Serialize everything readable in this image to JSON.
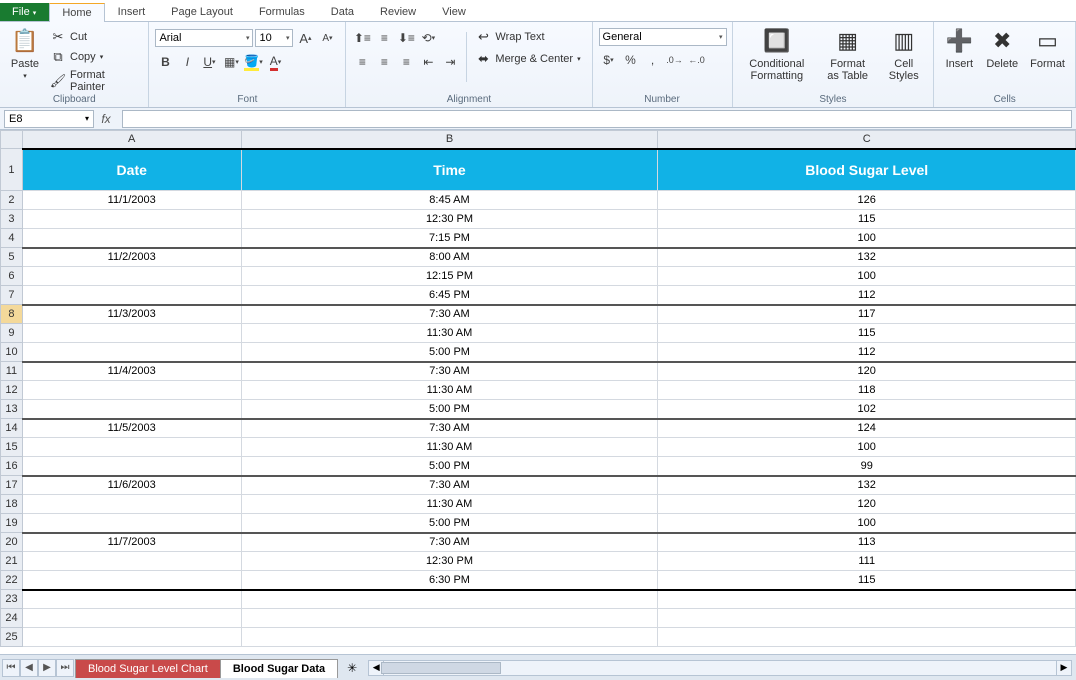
{
  "tabs": {
    "file": "File",
    "home": "Home",
    "insert": "Insert",
    "page_layout": "Page Layout",
    "formulas": "Formulas",
    "data": "Data",
    "review": "Review",
    "view": "View"
  },
  "clipboard": {
    "paste": "Paste",
    "cut": "Cut",
    "copy": "Copy",
    "format_painter": "Format Painter",
    "label": "Clipboard"
  },
  "font": {
    "name": "Arial",
    "size": "10",
    "label": "Font"
  },
  "alignment": {
    "wrap": "Wrap Text",
    "merge": "Merge & Center",
    "label": "Alignment"
  },
  "number": {
    "format": "General",
    "label": "Number"
  },
  "styles": {
    "cond": "Conditional Formatting",
    "table": "Format as Table",
    "cell": "Cell Styles",
    "label": "Styles"
  },
  "cells": {
    "insert": "Insert",
    "delete": "Delete",
    "format": "Format",
    "label": "Cells"
  },
  "namebox": "E8",
  "columns": [
    "A",
    "B",
    "C"
  ],
  "headers": {
    "A": "Date",
    "B": "Time",
    "C": "Blood Sugar Level"
  },
  "rows": [
    {
      "n": 2,
      "A": "11/1/2003",
      "B": "8:45 AM",
      "C": "126"
    },
    {
      "n": 3,
      "A": "",
      "B": "12:30 PM",
      "C": "115"
    },
    {
      "n": 4,
      "A": "",
      "B": "7:15 PM",
      "C": "100",
      "thick": true
    },
    {
      "n": 5,
      "A": "11/2/2003",
      "B": "8:00 AM",
      "C": "132"
    },
    {
      "n": 6,
      "A": "",
      "B": "12:15 PM",
      "C": "100"
    },
    {
      "n": 7,
      "A": "",
      "B": "6:45 PM",
      "C": "112",
      "thick": true
    },
    {
      "n": 8,
      "A": "11/3/2003",
      "B": "7:30 AM",
      "C": "117",
      "sel": true
    },
    {
      "n": 9,
      "A": "",
      "B": "11:30 AM",
      "C": "115"
    },
    {
      "n": 10,
      "A": "",
      "B": "5:00 PM",
      "C": "112",
      "thick": true
    },
    {
      "n": 11,
      "A": "11/4/2003",
      "B": "7:30 AM",
      "C": "120"
    },
    {
      "n": 12,
      "A": "",
      "B": "11:30 AM",
      "C": "118"
    },
    {
      "n": 13,
      "A": "",
      "B": "5:00 PM",
      "C": "102",
      "thick": true
    },
    {
      "n": 14,
      "A": "11/5/2003",
      "B": "7:30 AM",
      "C": "124"
    },
    {
      "n": 15,
      "A": "",
      "B": "11:30 AM",
      "C": "100"
    },
    {
      "n": 16,
      "A": "",
      "B": "5:00 PM",
      "C": "99",
      "thick": true
    },
    {
      "n": 17,
      "A": "11/6/2003",
      "B": "7:30 AM",
      "C": "132"
    },
    {
      "n": 18,
      "A": "",
      "B": "11:30 AM",
      "C": "120"
    },
    {
      "n": 19,
      "A": "",
      "B": "5:00 PM",
      "C": "100",
      "thick": true
    },
    {
      "n": 20,
      "A": "11/7/2003",
      "B": "7:30 AM",
      "C": "113"
    },
    {
      "n": 21,
      "A": "",
      "B": "12:30 PM",
      "C": "111"
    },
    {
      "n": 22,
      "A": "",
      "B": "6:30 PM",
      "C": "115",
      "thickest": true
    },
    {
      "n": 23,
      "A": "",
      "B": "",
      "C": ""
    },
    {
      "n": 24,
      "A": "",
      "B": "",
      "C": ""
    },
    {
      "n": 25,
      "A": "",
      "B": "",
      "C": ""
    }
  ],
  "sheets": {
    "chart": "Blood Sugar Level Chart",
    "data": "Blood Sugar Data"
  }
}
